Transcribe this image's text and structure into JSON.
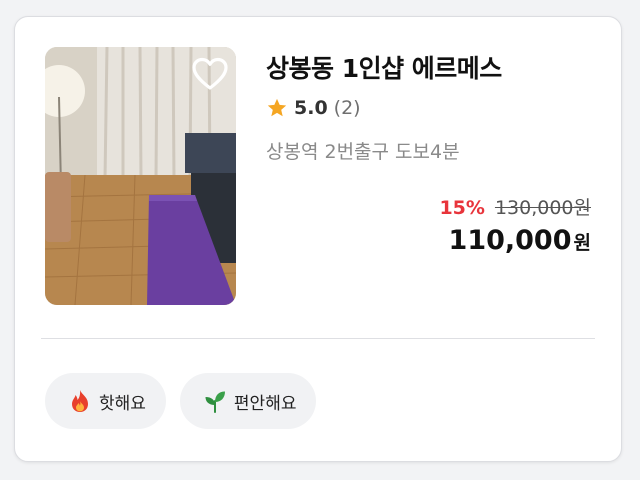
{
  "listing": {
    "title": "상봉동 1인샵 에르메스",
    "rating": "5.0",
    "review_count": "(2)",
    "location": "상봉역 2번출구 도보4분",
    "discount": "15%",
    "original_price": "130,000원",
    "price": "110,000",
    "currency": "원",
    "favorited": false
  },
  "icons": {
    "favorite": "heart-outline-icon",
    "rating": "star-icon",
    "tag_hot": "fire-icon",
    "tag_comfort": "leaf-icon"
  },
  "tags": [
    {
      "label": "핫해요",
      "icon": "fire-icon"
    },
    {
      "label": "편안해요",
      "icon": "leaf-icon"
    }
  ],
  "colors": {
    "discount": "#e8343b",
    "star": "#f5a623",
    "leaf": "#2f8f3f",
    "fire": "#e8402c"
  }
}
